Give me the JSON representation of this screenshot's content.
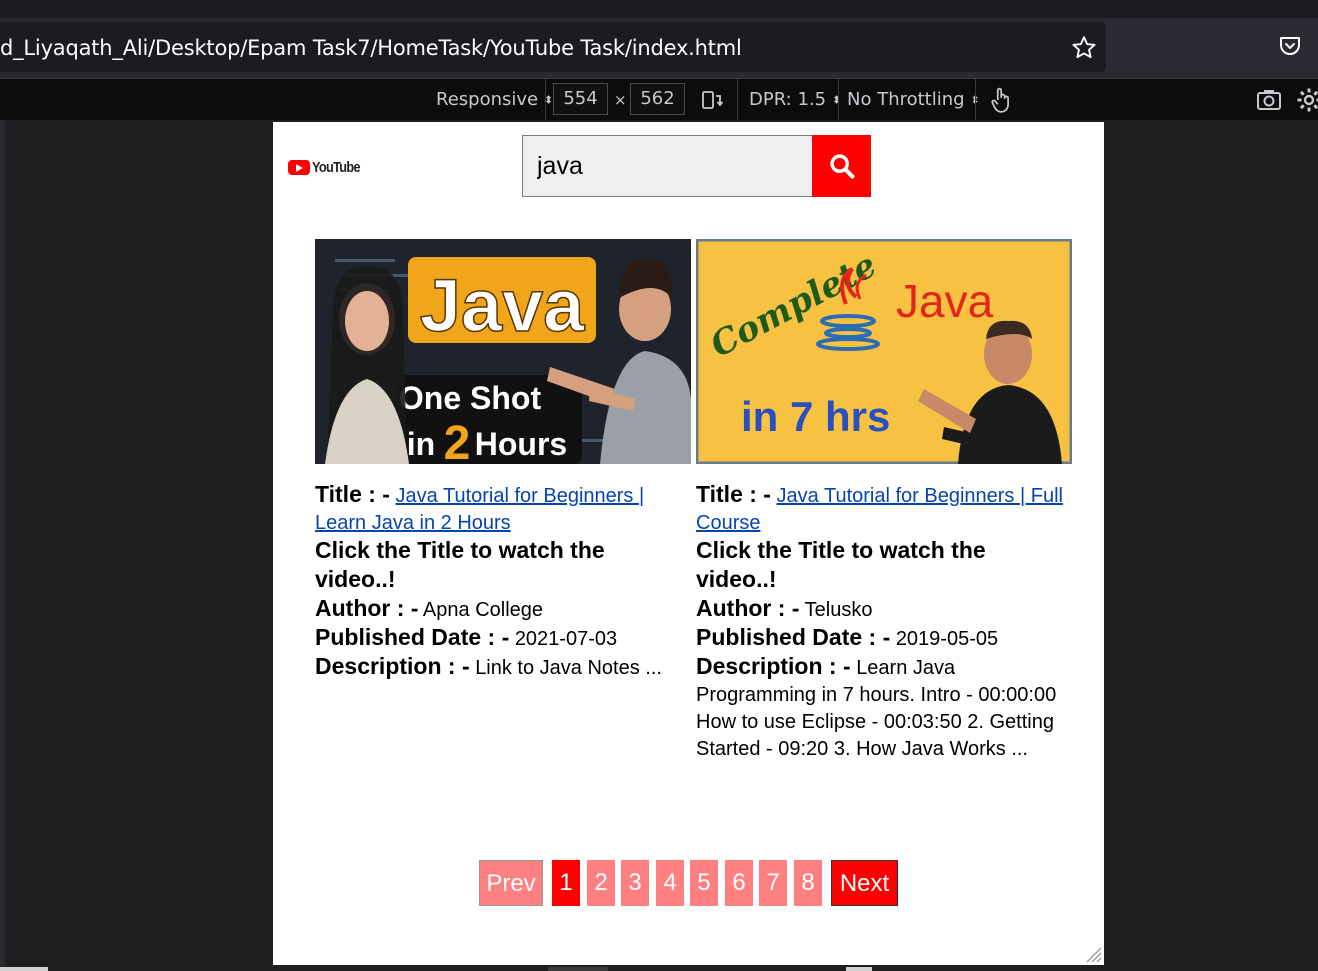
{
  "browser": {
    "url": "d_Liyaqath_Ali/Desktop/Epam Task7/HomeTask/YouTube Task/index.html"
  },
  "rdm": {
    "device": "Responsive",
    "width": "554",
    "times": "×",
    "height": "562",
    "dpr": "DPR: 1.5",
    "throttling": "No Throttling"
  },
  "page": {
    "logo_text": "YouTube",
    "search_value": "java",
    "cards": [
      {
        "title_label": "Title : -",
        "title_link": "Java Tutorial for Beginners | Learn Java in 2 Hours",
        "click_hint": "Click the Title to watch the video..!",
        "author_label": "Author : -",
        "author": "Apna College",
        "date_label": "Published Date : -",
        "date": "2021-07-03",
        "desc_label": "Description : -",
        "description": "Link to Java Notes ...",
        "thumb_text": [
          "Java",
          "One Shot",
          "in",
          "2",
          "Hours"
        ]
      },
      {
        "title_label": "Title : -",
        "title_link": "Java Tutorial for Beginners | Full Course",
        "click_hint": "Click the Title to watch the video..!",
        "author_label": "Author : -",
        "author": "Telusko",
        "date_label": "Published Date : -",
        "date": "2019-05-05",
        "desc_label": "Description : -",
        "description": "Learn Java Programming in 7 hours. Intro - 00:00:00 How to use Eclipse - 00:03:50 2. Getting Started - 09:20 3. How Java Works ...",
        "thumb_text": [
          "Complete",
          "Java",
          "in 7 hrs"
        ]
      }
    ],
    "pagination": {
      "prev": "Prev",
      "pages": [
        "1",
        "2",
        "3",
        "4",
        "5",
        "6",
        "7",
        "8"
      ],
      "active": "1",
      "next": "Next"
    }
  },
  "colors": {
    "accent": "#ff0000",
    "inactive_page": "#ff8080",
    "link": "#0645ad"
  }
}
